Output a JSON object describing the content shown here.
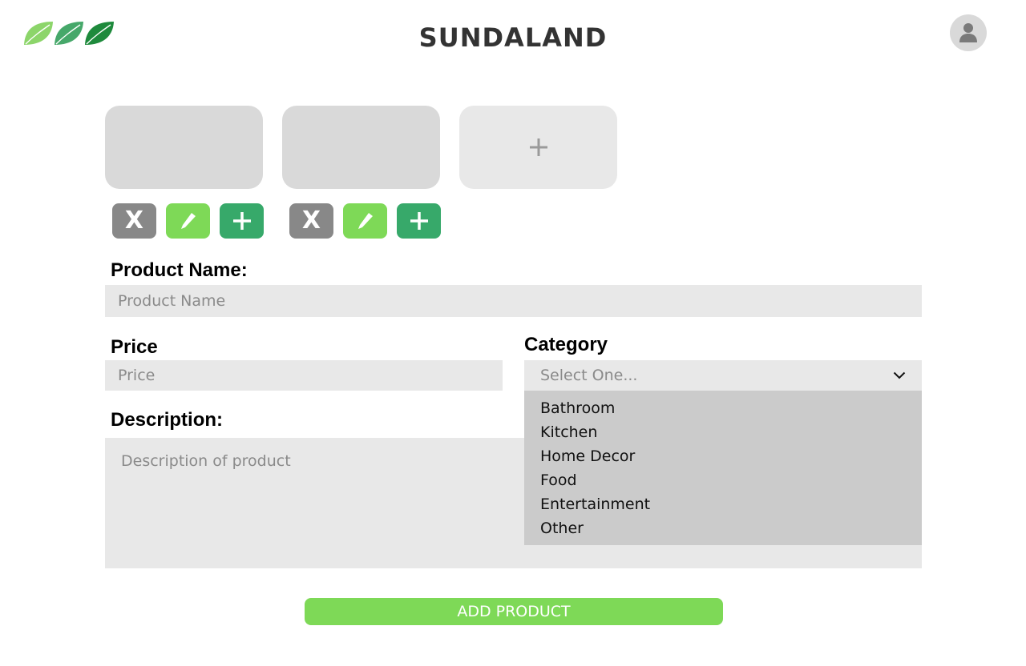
{
  "header": {
    "brand": "SUNDALAND",
    "logo_icon": "leaf-icon",
    "avatar_icon": "user-icon"
  },
  "images": {
    "add_tile_icon": "plus-icon",
    "tiles": [
      {
        "delete_label": "X",
        "edit_icon": "pencil-icon",
        "add_icon": "plus-icon"
      },
      {
        "delete_label": "X",
        "edit_icon": "pencil-icon",
        "add_icon": "plus-icon"
      }
    ]
  },
  "form": {
    "product_name": {
      "label": "Product Name:",
      "placeholder": "Product Name",
      "value": ""
    },
    "price": {
      "label": "Price",
      "placeholder": "Price",
      "value": ""
    },
    "category": {
      "label": "Category",
      "selected": "Select One...",
      "options": [
        "Bathroom",
        "Kitchen",
        "Home Decor",
        "Food",
        "Entertainment",
        "Other"
      ]
    },
    "description": {
      "label": "Description:",
      "placeholder": "Description of product",
      "value": ""
    },
    "submit_label": "ADD PRODUCT"
  },
  "colors": {
    "accent_green": "#7ed957",
    "dark_green": "#37a96a",
    "delete_gray": "#888888",
    "field_bg": "#e8e8e8",
    "dropdown_bg": "#cbcbcb"
  }
}
